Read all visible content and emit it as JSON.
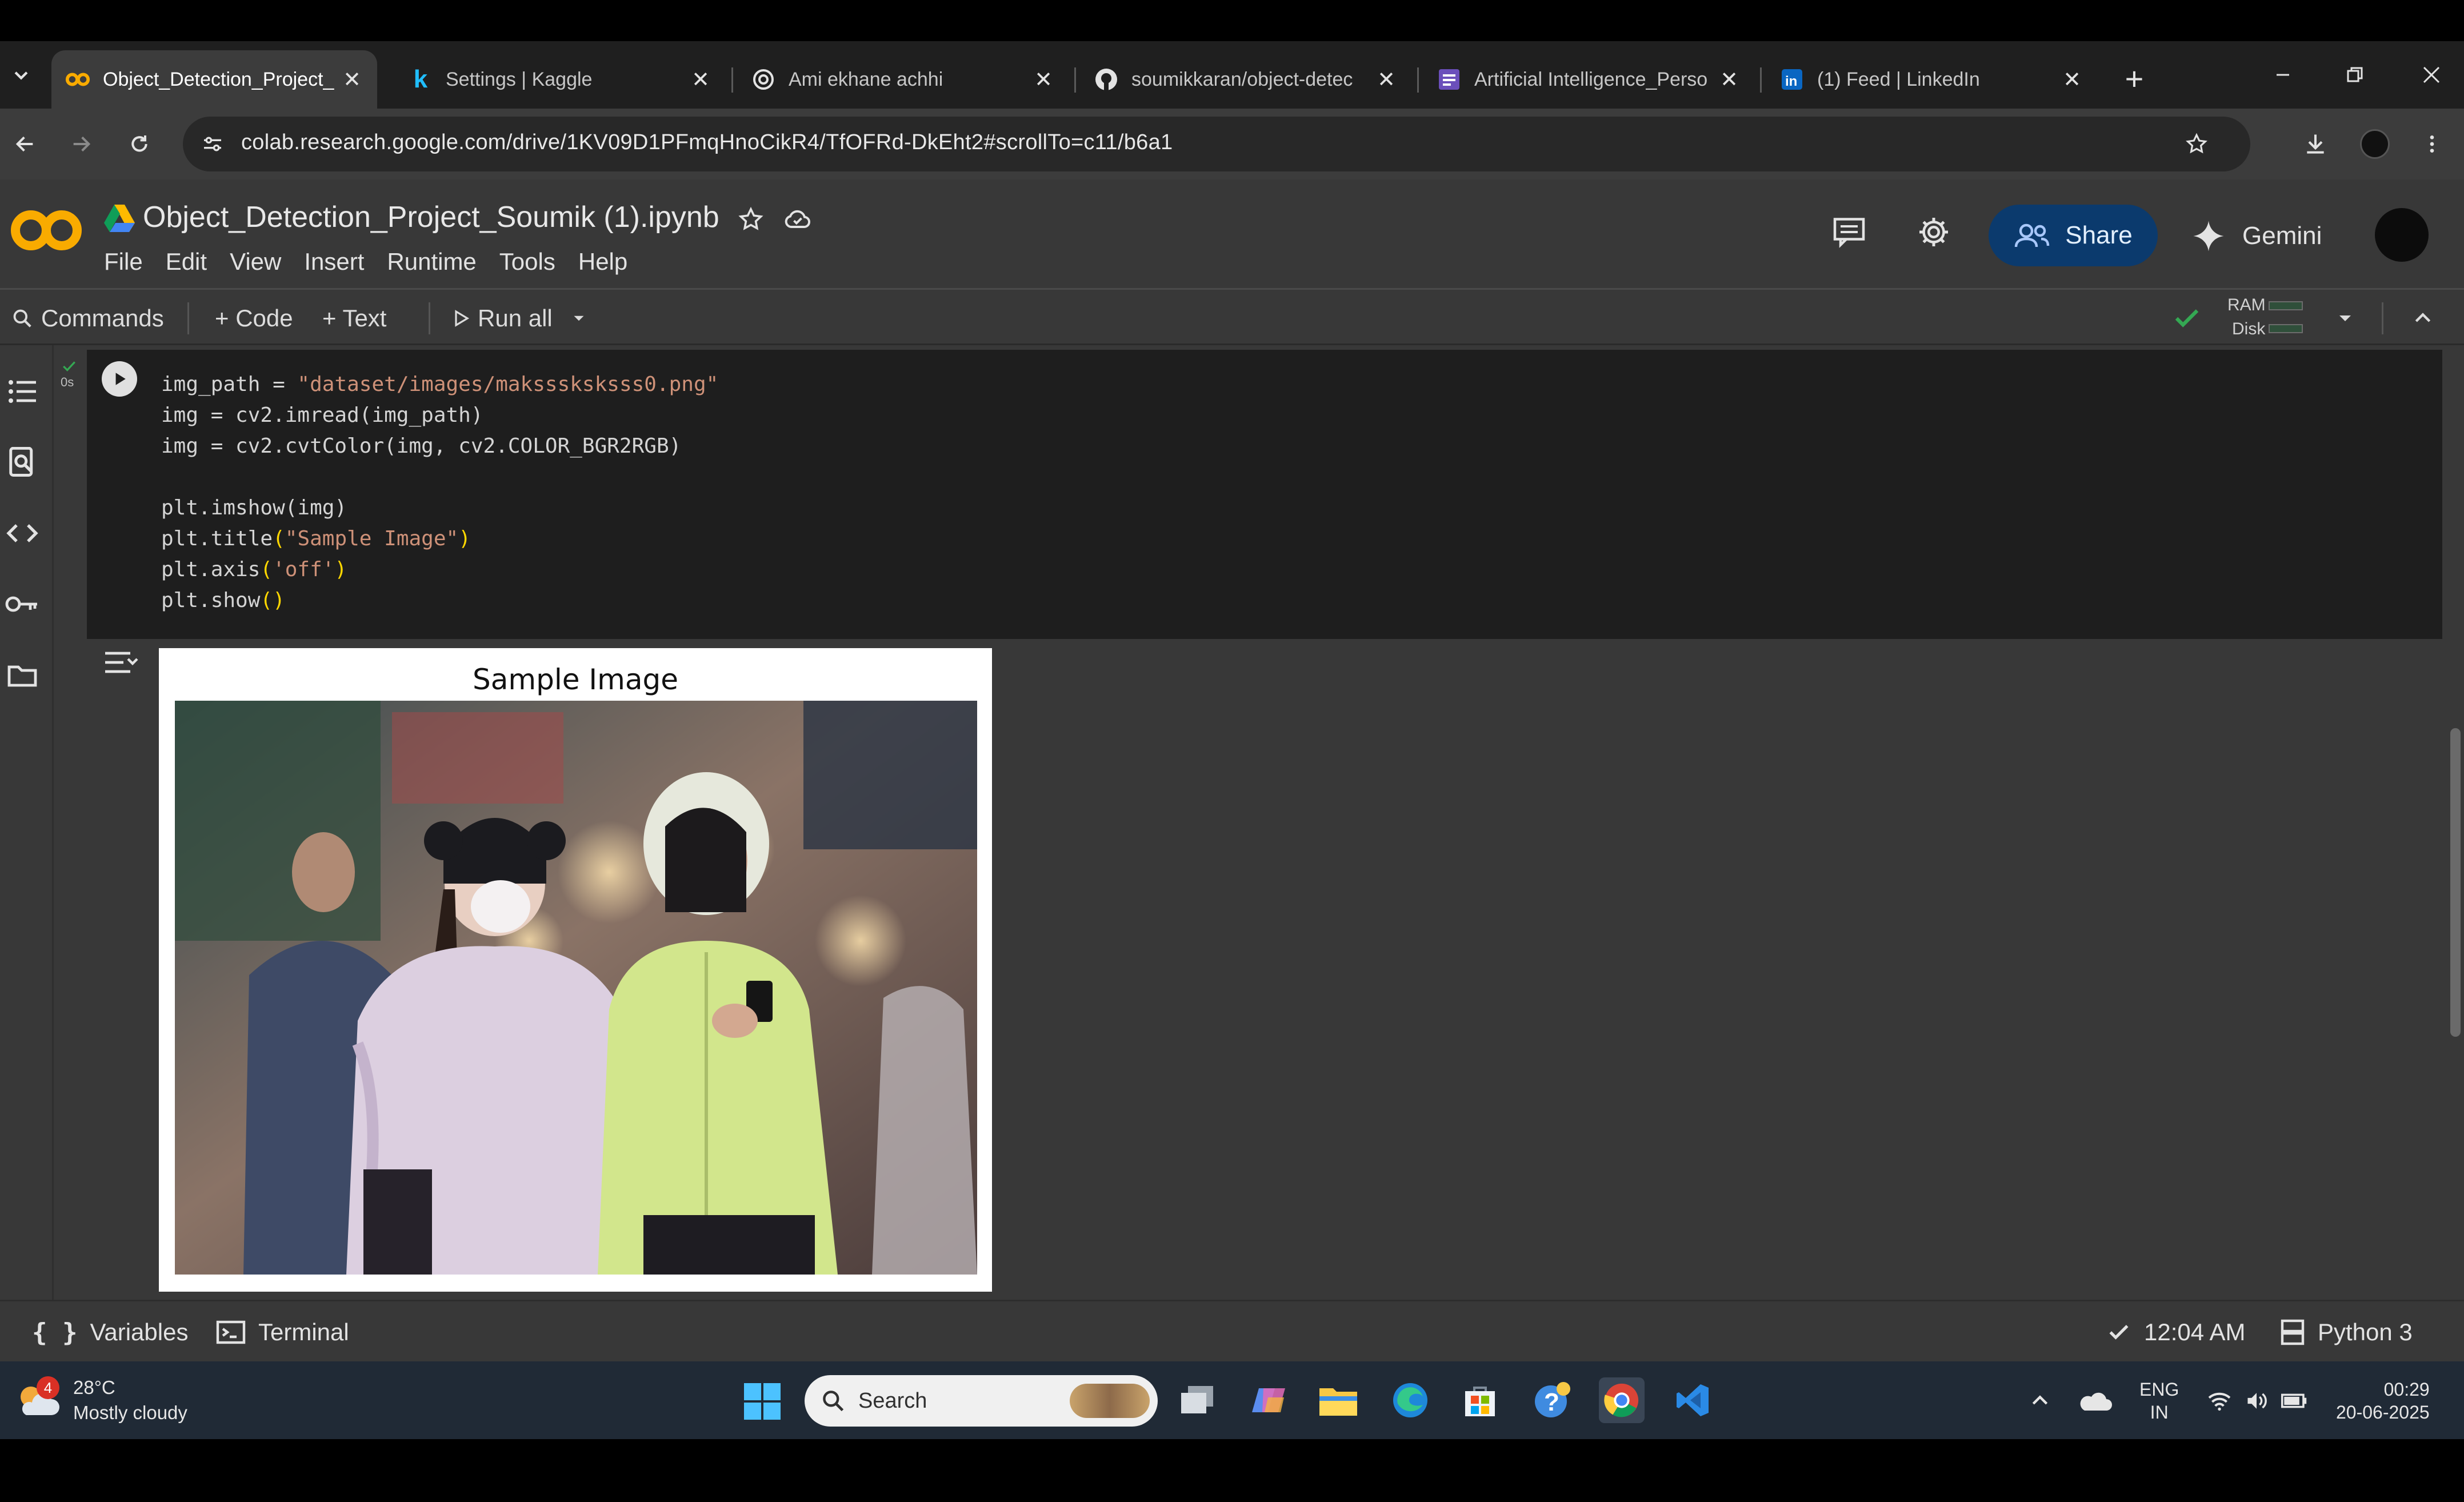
{
  "browser": {
    "tabs": [
      {
        "title": "Object_Detection_Project_",
        "favicon": "colab-icon",
        "active": true
      },
      {
        "title": "Settings | Kaggle",
        "favicon": "kaggle-icon",
        "active": false
      },
      {
        "title": "Ami ekhane achhi",
        "favicon": "openai-icon",
        "active": false
      },
      {
        "title": "soumikkaran/object-detec",
        "favicon": "github-icon",
        "active": false
      },
      {
        "title": "Artificial Intelligence_Perso",
        "favicon": "notion-icon",
        "active": false
      },
      {
        "title": "(1) Feed | LinkedIn",
        "favicon": "linkedin-icon",
        "active": false
      }
    ],
    "url": "colab.research.google.com/drive/1KV09D1PFmqHnoCikR4/TfOFRd-DkEht2#scrollTo=c11/b6a1"
  },
  "colab": {
    "notebook_title": "Object_Detection_Project_Soumik (1).ipynb",
    "menu": [
      "File",
      "Edit",
      "View",
      "Insert",
      "Runtime",
      "Tools",
      "Help"
    ],
    "share_label": "Share",
    "gemini_label": "Gemini",
    "commands_label": "Commands",
    "add_code_label": "+ Code",
    "add_text_label": "+ Text",
    "run_all_label": "Run all",
    "ram_label": "RAM",
    "disk_label": "Disk",
    "exec_time": "0s",
    "code_lines": [
      "img_path = \"dataset/images/maksssksksss0.png\"",
      "img = cv2.imread(img_path)",
      "img = cv2.cvtColor(img, cv2.COLOR_BGR2RGB)",
      "",
      "plt.imshow(img)",
      "plt.title(\"Sample Image\")",
      "plt.axis('off')",
      "plt.show()"
    ],
    "figure_title": "Sample Image",
    "status": {
      "variables_label": "Variables",
      "terminal_label": "Terminal",
      "time": "12:04 AM",
      "kernel": "Python 3"
    }
  },
  "taskbar": {
    "weather_temp": "28°C",
    "weather_desc": "Mostly cloudy",
    "weather_badge": "4",
    "search_placeholder": "Search",
    "lang_top": "ENG",
    "lang_bottom": "IN",
    "clock_time": "00:29",
    "clock_date": "20-06-2025"
  },
  "colors": {
    "tab_strip": "#1f1f1f",
    "toolbar": "#3c3c3c",
    "colab_bg": "#383838",
    "code_bg": "#1e1e1e",
    "share_bg": "#0b3a6d",
    "colab_orange": "#f9ab00",
    "taskbar": "#202a36"
  }
}
